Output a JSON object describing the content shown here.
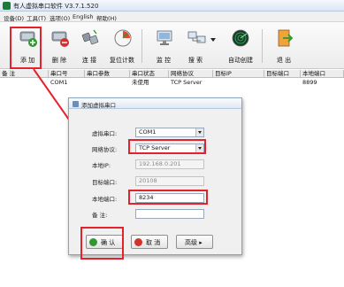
{
  "window": {
    "title": "有人虚拟串口软件 V3.7.1.520"
  },
  "menu": [
    "设备(D)",
    "工具(T)",
    "选项(O)",
    "English",
    "帮助(H)"
  ],
  "toolbar": {
    "add": "添 加",
    "remove": "删 除",
    "connect": "连 接",
    "reset_count": "复位计数",
    "monitor": "监 控",
    "search": "搜 索",
    "auto_create": "自动创建",
    "exit": "退 出"
  },
  "table": {
    "columns": [
      "备 注",
      "串口号",
      "串口参数",
      "串口状态",
      "网络协议",
      "目标IP",
      "目标端口",
      "本地端口"
    ],
    "rows": [
      {
        "remark": "",
        "port": "COM1",
        "params": "",
        "status": "未使用",
        "protocol": "TCP Server",
        "target_ip": "",
        "target_port": "",
        "local_port": "8899"
      }
    ]
  },
  "dialog": {
    "title": "添加虚拟串口",
    "labels": {
      "virtual_port": "虚拟串口:",
      "protocol": "网络协议:",
      "local_ip": "本地IP:",
      "target_port": "目标端口:",
      "local_port": "本地端口:",
      "remark": "备 注:"
    },
    "values": {
      "virtual_port": "COM1",
      "protocol": "TCP Server",
      "local_ip": "192.168.0.201",
      "target_port": "20108",
      "local_port": "8234",
      "remark": ""
    },
    "buttons": {
      "confirm": "确 认",
      "cancel": "取 消",
      "advanced": "高级 ▸"
    }
  },
  "colors": {
    "highlight": "#e4222d",
    "confirm_icon": "#2e9a2e",
    "cancel_icon": "#d2312e"
  }
}
